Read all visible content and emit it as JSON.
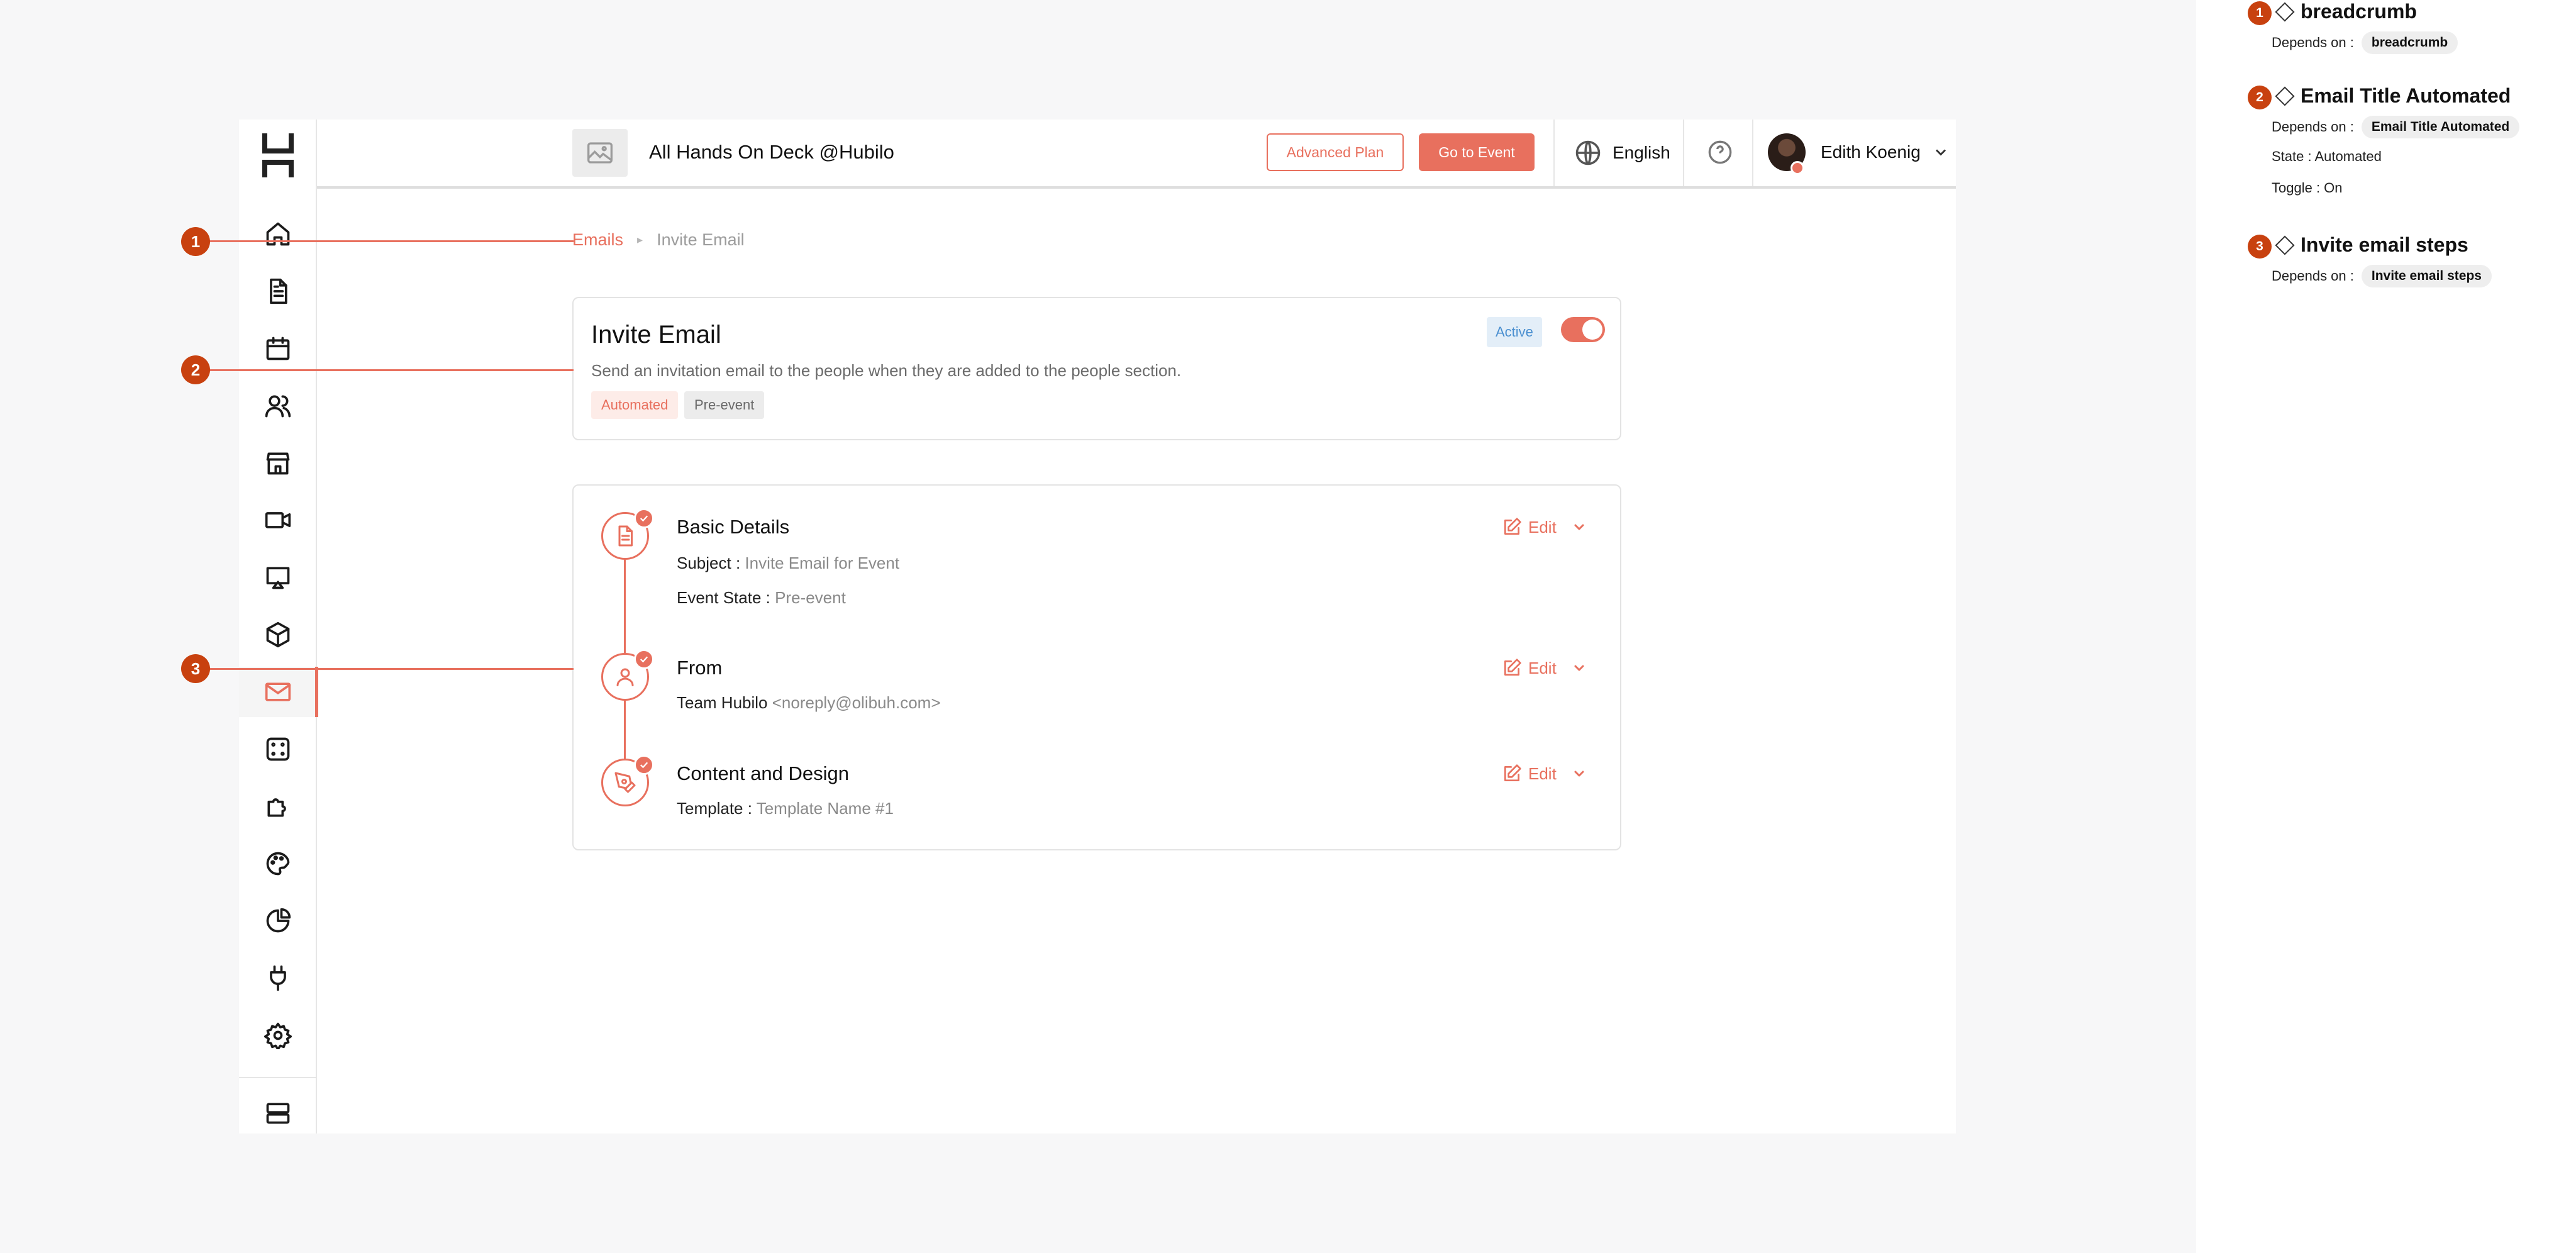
{
  "topbar": {
    "event_title": "All Hands On Deck @Hubilo",
    "advanced_plan_label": "Advanced Plan",
    "go_to_event_label": "Go to Event",
    "language": "English",
    "user_name": "Edith Koenig"
  },
  "sidebar": {
    "items": [
      "home",
      "document",
      "calendar",
      "people",
      "store",
      "video",
      "screen",
      "cube",
      "email",
      "dice",
      "puzzle",
      "palette",
      "pie-chart",
      "plug",
      "settings"
    ],
    "active": "email",
    "bottom_item": "server"
  },
  "breadcrumb": {
    "parent": "Emails",
    "current": "Invite Email"
  },
  "email_card": {
    "title": "Invite Email",
    "description": "Send an invitation email to the people when they are added to the people section.",
    "tags": [
      "Automated",
      "Pre-event"
    ],
    "status": "Active",
    "toggle_on": true
  },
  "steps": [
    {
      "title": "Basic Details",
      "edit_label": "Edit",
      "lines": [
        {
          "label": "Subject : ",
          "value": "Invite Email for Event"
        },
        {
          "label": "Event State : ",
          "value": "Pre-event"
        }
      ]
    },
    {
      "title": "From",
      "edit_label": "Edit",
      "lines": [
        {
          "label": "Team Hubilo ",
          "value": "<noreply@olibuh.com>"
        }
      ]
    },
    {
      "title": "Content and Design",
      "edit_label": "Edit",
      "lines": [
        {
          "label": "Template : ",
          "value": "Template Name #1"
        }
      ]
    }
  ],
  "annotations": [
    {
      "num": "1",
      "title": "breadcrumb",
      "depends_label": "Depends on :",
      "depends": "breadcrumb",
      "extra": []
    },
    {
      "num": "2",
      "title": "Email Title Automated",
      "depends_label": "Depends on :",
      "depends": "Email Title Automated",
      "extra": [
        "State : Automated",
        "Toggle : On"
      ]
    },
    {
      "num": "3",
      "title": "Invite email steps",
      "depends_label": "Depends on :",
      "depends": "Invite email steps",
      "extra": []
    }
  ],
  "colors": {
    "accent": "#e8705e",
    "annotation": "#c8410f",
    "active_badge_bg": "#e3eef8",
    "active_badge_text": "#4a8fd0"
  }
}
